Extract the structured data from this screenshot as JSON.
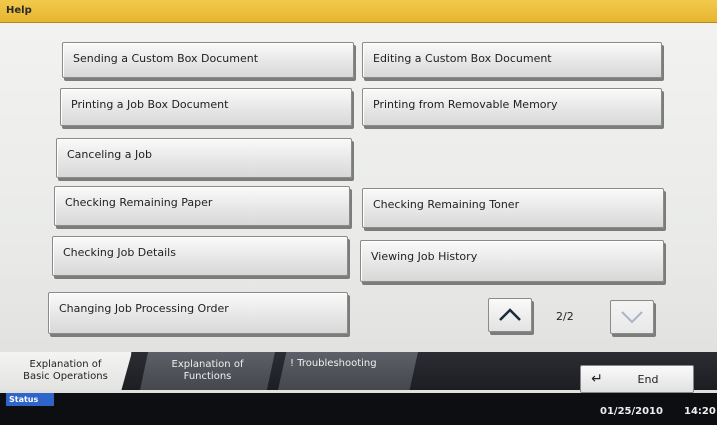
{
  "title": "Help",
  "buttons": {
    "sending_custom_box": "Sending a Custom Box Document",
    "editing_custom_box": "Editing a Custom Box Document",
    "printing_job_box": "Printing a Job Box Document",
    "printing_removable": "Printing from Removable Memory",
    "canceling_job": "Canceling a Job",
    "checking_paper": "Checking Remaining Paper",
    "checking_toner": "Checking Remaining Toner",
    "checking_job_details": "Checking Job Details",
    "viewing_job_history": "Viewing Job History",
    "changing_job_order": "Changing Job Processing Order"
  },
  "pagination": {
    "indicator": "2/2"
  },
  "tabs": {
    "basic_line1": "Explanation of",
    "basic_line2": "Basic Operations",
    "functions_line1": "Explanation of",
    "functions_line2": "Functions",
    "troubleshooting": "! Troubleshooting"
  },
  "end_label": "End",
  "status": {
    "label": "Status",
    "date": "01/25/2010",
    "time": "14:20"
  },
  "icons": {
    "up": "chevron-up-icon",
    "down": "chevron-down-icon",
    "end": "return-arrow-icon"
  }
}
